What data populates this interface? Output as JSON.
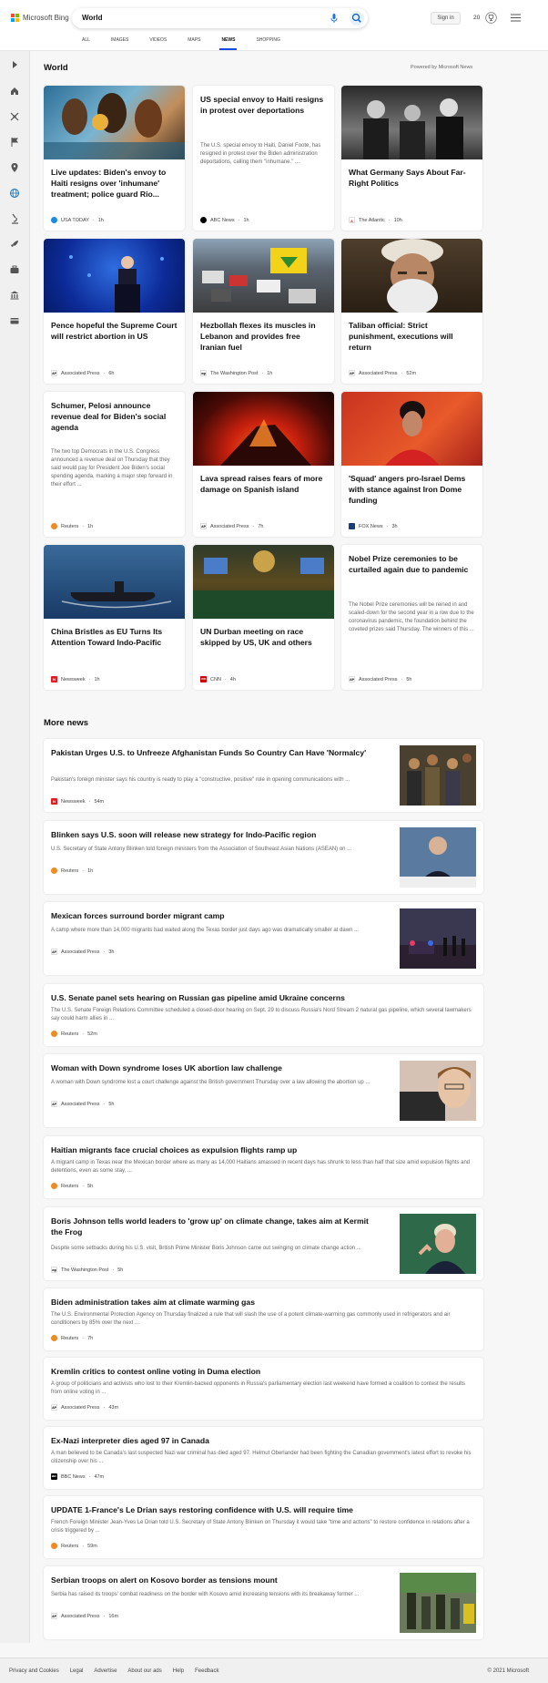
{
  "brand": {
    "name": "Microsoft Bing",
    "colors": [
      "#f25022",
      "#7fba00",
      "#00a4ef",
      "#ffb900"
    ]
  },
  "search": {
    "query": "World"
  },
  "header": {
    "signin_label": "Sign in",
    "rewards_count": "20"
  },
  "tabs": [
    {
      "label": "ALL"
    },
    {
      "label": "IMAGES"
    },
    {
      "label": "VIDEOS"
    },
    {
      "label": "MAPS"
    },
    {
      "label": "NEWS",
      "active": true
    },
    {
      "label": "SHOPPING"
    }
  ],
  "rail": [
    "play-icon",
    "home-icon",
    "crosshair-icon",
    "flag-icon",
    "location-pin-icon",
    "globe-icon",
    "microscope-icon",
    "rocket-icon",
    "briefcase-icon",
    "bank-icon",
    "credit-card-icon"
  ],
  "section": {
    "title": "World",
    "powered": "Powered by Microsoft News"
  },
  "cards": [
    {
      "title": "Live updates: Biden's envoy to Haiti resigns over 'inhumane' treatment; police guard Rio...",
      "source": "USA TODAY",
      "time": "1h"
    },
    {
      "title": "US special envoy to Haiti resigns in protest over deportations",
      "desc": "The U.S. special envoy to Haiti, Daniel Foote, has resigned in protest over the Biden administration deportations, calling them \"inhumane.\" ...",
      "source": "ABC News",
      "time": "1h"
    },
    {
      "title": "What Germany Says About Far-Right Politics",
      "source": "The Atlantic",
      "time": "10h"
    },
    {
      "title": "Pence hopeful the Supreme Court will restrict abortion in US",
      "source": "Associated Press",
      "time": "6h"
    },
    {
      "title": "Hezbollah flexes its muscles in Lebanon and provides free Iranian fuel",
      "source": "The Washington Post",
      "time": "1h"
    },
    {
      "title": "Taliban official: Strict punishment, executions will return",
      "source": "Associated Press",
      "time": "52m"
    },
    {
      "title": "Schumer, Pelosi announce revenue deal for Biden's social agenda",
      "desc": "The two top Democrats in the U.S. Congress announced a revenue deal on Thursday that they said would pay for President Joe Biden's social spending agenda, marking a major step forward in their effort ...",
      "source": "Reuters",
      "time": "1h"
    },
    {
      "title": "Lava spread raises fears of more damage on Spanish island",
      "source": "Associated Press",
      "time": "7h"
    },
    {
      "title": "'Squad' angers pro-Israel Dems with stance against Iron Dome funding",
      "source": "FOX News",
      "time": "3h"
    },
    {
      "title": "China Bristles as EU Turns Its Attention Toward Indo-Pacific",
      "source": "Newsweek",
      "time": "1h"
    },
    {
      "title": "UN Durban meeting on race skipped by US, UK and others",
      "source": "CNN",
      "time": "4h"
    },
    {
      "title": "Nobel Prize ceremonies to be curtailed again due to pandemic",
      "desc": "The Nobel Prize ceremonies will be reined in and scaled-down for the second year in a row due to the coronavirus pandemic, the foundation behind the coveted prizes said Thursday. The winners of this ...",
      "source": "Associated Press",
      "time": "5h"
    }
  ],
  "more_news": {
    "title": "More news",
    "items": [
      {
        "title": "Pakistan Urges U.S. to Unfreeze Afghanistan Funds So Country Can Have 'Normalcy'",
        "desc": "Pakistan's foreign minister says his country is ready to play a \"constructive, positive\" role in opening communications with ...",
        "source": "Newsweek",
        "time": "54m"
      },
      {
        "title": "Blinken says U.S. soon will release new strategy for Indo-Pacific region",
        "desc": "U.S. Secretary of State Antony Blinken told foreign ministers from the Association of Southeast Asian Nations (ASEAN) on ...",
        "source": "Reuters",
        "time": "1h"
      },
      {
        "title": "Mexican forces surround border migrant camp",
        "desc": "A camp where more than 14,000 migrants had waited along the Texas border just days ago was dramatically smaller at dawn ...",
        "source": "Associated Press",
        "time": "3h"
      },
      {
        "title": "U.S. Senate panel sets hearing on Russian gas pipeline amid Ukraine concerns",
        "desc": "The U.S. Senate Foreign Relations Committee scheduled a closed-door hearing on Sept. 29 to discuss Russia's Nord Stream 2 natural gas pipeline, which several lawmakers say could harm allies in ...",
        "source": "Reuters",
        "time": "52m"
      },
      {
        "title": "Woman with Down syndrome loses UK abortion law challenge",
        "desc": "A woman with Down syndrome lost a court challenge against the British government Thursday over a law allowing the abortion up ...",
        "source": "Associated Press",
        "time": "5h"
      },
      {
        "title": "Haitian migrants face crucial choices as expulsion flights ramp up",
        "desc": "A migrant camp in Texas near the Mexican border where as many as 14,000 Haitians amassed in recent days has shrunk to less than half that size amid expulsion flights and detentions, even as some stay, ...",
        "source": "Reuters",
        "time": "5h"
      },
      {
        "title": "Boris Johnson tells world leaders to 'grow up' on climate change, takes aim at Kermit the Frog",
        "desc": "Despite some setbacks during his U.S. visit, British Prime Minister Boris Johnson came out swinging on climate change action ...",
        "source": "The Washington Post",
        "time": "5h"
      },
      {
        "title": "Biden administration takes aim at climate warming gas",
        "desc": "The U.S. Environmental Protection Agency on Thursday finalized a rule that will slash the use of a potent climate-warming gas commonly used in refrigerators and air conditioners by 85% over the next ...",
        "source": "Reuters",
        "time": "7h"
      },
      {
        "title": "Kremlin critics to contest online voting in Duma election",
        "desc": "A group of politicians and activists who lost to their Kremlin-backed opponents in Russia's parliamentary election last weekend have formed a coalition to contest the results from online voting in ...",
        "source": "Associated Press",
        "time": "43m"
      },
      {
        "title": "Ex-Nazi interpreter dies aged 97 in Canada",
        "desc": "A man believed to be Canada's last suspected Nazi war criminal has died aged 97. Helmut Oberlander had been fighting the Canadian government's latest effort to revoke his citizenship over his ...",
        "source": "BBC News",
        "time": "47m"
      },
      {
        "title": "UPDATE 1-France's Le Drian says restoring confidence with U.S. will require time",
        "desc": "French Foreign Minister Jean-Yves Le Drian told U.S. Secretary of State Antony Blinken on Thursday it would take \"time and actions\" to restore confidence in relations after a crisis triggered by ...",
        "source": "Reuters",
        "time": "59m"
      },
      {
        "title": "Serbian troops on alert on Kosovo border as tensions mount",
        "desc": "Serbia has raised its troops' combat readiness on the border with Kosovo amid increasing tensions with its breakaway former ...",
        "source": "Associated Press",
        "time": "16m"
      }
    ]
  },
  "source_logos": {
    "USA TODAY": {
      "mark": "",
      "color": "#1a8ce6"
    },
    "ABC News": {
      "mark": "",
      "color": "#000000"
    },
    "The Atlantic": {
      "mark": "A",
      "color": "#e0211a"
    },
    "Associated Press": {
      "mark": "AP",
      "color": "#000000"
    },
    "The Washington Post": {
      "mark": "wp",
      "color": "#000000"
    },
    "Reuters": {
      "mark": "",
      "color": "#f08a24"
    },
    "FOX News": {
      "mark": "",
      "color": "#1b3d7a"
    },
    "Newsweek": {
      "mark": "N",
      "color": "#e31b23"
    },
    "CNN": {
      "mark": "CNN",
      "color": "#cc0000"
    },
    "BBC News": {
      "mark": "BBC",
      "color": "#000000"
    }
  },
  "footer": {
    "links": [
      "Privacy and Cookies",
      "Legal",
      "Advertise",
      "About our ads",
      "Help",
      "Feedback"
    ],
    "copyright": "© 2021 Microsoft"
  }
}
